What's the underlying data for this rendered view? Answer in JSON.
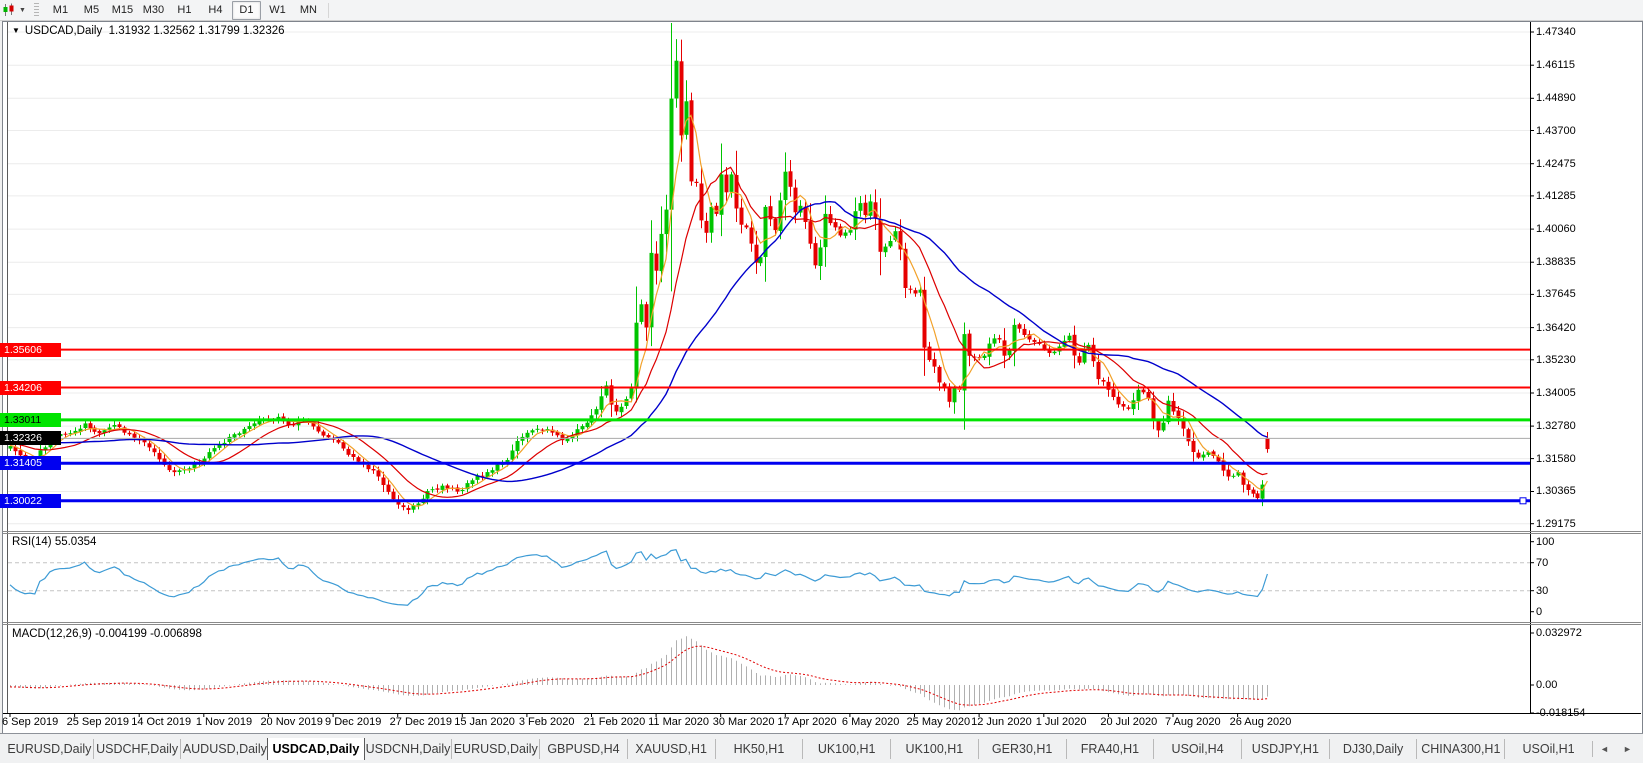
{
  "toolbar": {
    "timeframes": [
      "M1",
      "M5",
      "M15",
      "M30",
      "H1",
      "H4",
      "D1",
      "W1",
      "MN"
    ],
    "active_timeframe": "D1"
  },
  "chart_window": {
    "title": "USDCAD,Daily",
    "ohlc_text": "1.31932 1.32562 1.31799 1.32326"
  },
  "chart_data": {
    "type": "candlestick",
    "symbol": "USDCAD",
    "period": "Daily",
    "title": "USDCAD,Daily  1.31932 1.32562 1.31799 1.32326",
    "last_candle": {
      "open": 1.31932,
      "high": 1.32562,
      "low": 1.31799,
      "close": 1.32326,
      "render_color": "#e60000"
    },
    "candle_up_color": "#00c400",
    "candle_down_color": "#e60000",
    "grid_color": "#ececec",
    "price_axis": {
      "ticks": [
        "1.47340",
        "1.46115",
        "1.44890",
        "1.43700",
        "1.42475",
        "1.41285",
        "1.40060",
        "1.38835",
        "1.37645",
        "1.36420",
        "1.35230",
        "1.34005",
        "1.32780",
        "1.31580",
        "1.30365",
        "1.29175"
      ]
    },
    "time_axis": {
      "labels": [
        "6 Sep 2019",
        "25 Sep 2019",
        "14 Oct 2019",
        "1 Nov 2019",
        "20 Nov 2019",
        "9 Dec 2019",
        "27 Dec 2019",
        "15 Jan 2020",
        "3 Feb 2020",
        "21 Feb 2020",
        "11 Mar 2020",
        "30 Mar 2020",
        "17 Apr 2020",
        "6 May 2020",
        "25 May 2020",
        "12 Jun 2020",
        "1 Jul 2020",
        "20 Jul 2020",
        "7 Aug 2020",
        "26 Aug 2020"
      ],
      "label_interval_days": 13
    },
    "close_keypoints": [
      [
        0,
        1.3205
      ],
      [
        2,
        1.317
      ],
      [
        5,
        1.3152
      ],
      [
        8,
        1.323
      ],
      [
        12,
        1.3252
      ],
      [
        15,
        1.3288
      ],
      [
        18,
        1.3252
      ],
      [
        21,
        1.3282
      ],
      [
        24,
        1.3248
      ],
      [
        27,
        1.3218
      ],
      [
        30,
        1.3155
      ],
      [
        33,
        1.3108
      ],
      [
        36,
        1.3122
      ],
      [
        39,
        1.3158
      ],
      [
        42,
        1.3212
      ],
      [
        45,
        1.3248
      ],
      [
        48,
        1.3278
      ],
      [
        51,
        1.3302
      ],
      [
        54,
        1.3312
      ],
      [
        56,
        1.3282
      ],
      [
        59,
        1.33
      ],
      [
        62,
        1.3258
      ],
      [
        65,
        1.3228
      ],
      [
        68,
        1.3172
      ],
      [
        71,
        1.3138
      ],
      [
        74,
        1.3092
      ],
      [
        76,
        1.3035
      ],
      [
        78,
        1.2988
      ],
      [
        80,
        1.2968
      ],
      [
        82,
        1.2992
      ],
      [
        84,
        1.3038
      ],
      [
        87,
        1.3058
      ],
      [
        90,
        1.3036
      ],
      [
        93,
        1.3078
      ],
      [
        96,
        1.3108
      ],
      [
        99,
        1.3142
      ],
      [
        101,
        1.3188
      ],
      [
        103,
        1.3238
      ],
      [
        106,
        1.3268
      ],
      [
        109,
        1.3254
      ],
      [
        111,
        1.3226
      ],
      [
        113,
        1.3244
      ],
      [
        115,
        1.3278
      ],
      [
        117,
        1.3318
      ],
      [
        119,
        1.3388
      ],
      [
        120,
        1.3428
      ],
      [
        122,
        1.3332
      ],
      [
        124,
        1.3378
      ],
      [
        125,
        1.342
      ],
      [
        126,
        1.366
      ],
      [
        127,
        1.3728
      ],
      [
        128,
        1.3642
      ],
      [
        129,
        1.3918
      ],
      [
        130,
        1.3852
      ],
      [
        131,
        1.3988
      ],
      [
        132,
        1.4078
      ],
      [
        133,
        1.4488
      ],
      [
        134,
        1.4628
      ],
      [
        135,
        1.4352
      ],
      [
        136,
        1.4478
      ],
      [
        137,
        1.4182
      ],
      [
        138,
        1.4176
      ],
      [
        139,
        1.4038
      ],
      [
        140,
        1.3992
      ],
      [
        141,
        1.4088
      ],
      [
        142,
        1.4062
      ],
      [
        143,
        1.4208
      ],
      [
        144,
        1.4142
      ],
      [
        145,
        1.4208
      ],
      [
        146,
        1.4082
      ],
      [
        147,
        1.4022
      ],
      [
        148,
        1.4012
      ],
      [
        149,
        1.3952
      ],
      [
        150,
        1.3882
      ],
      [
        151,
        1.3902
      ],
      [
        152,
        1.4088
      ],
      [
        153,
        1.4042
      ],
      [
        154,
        1.4002
      ],
      [
        155,
        1.4112
      ],
      [
        156,
        1.4218
      ],
      [
        157,
        1.4162
      ],
      [
        158,
        1.4068
      ],
      [
        159,
        1.4092
      ],
      [
        160,
        1.4032
      ],
      [
        161,
        1.3952
      ],
      [
        162,
        1.3872
      ],
      [
        163,
        1.3938
      ],
      [
        164,
        1.4062
      ],
      [
        165,
        1.4028
      ],
      [
        167,
        1.3982
      ],
      [
        169,
        1.4002
      ],
      [
        171,
        1.4102
      ],
      [
        172,
        1.4058
      ],
      [
        173,
        1.4108
      ],
      [
        175,
        1.3922
      ],
      [
        177,
        1.3962
      ],
      [
        178,
        1.3998
      ],
      [
        180,
        1.3788
      ],
      [
        182,
        1.3768
      ],
      [
        183,
        1.3782
      ],
      [
        184,
        1.3568
      ],
      [
        185,
        1.3522
      ],
      [
        186,
        1.3498
      ],
      [
        188,
        1.3422
      ],
      [
        189,
        1.3368
      ],
      [
        190,
        1.3422
      ],
      [
        191,
        1.3412
      ],
      [
        192,
        1.3618
      ],
      [
        193,
        1.3538
      ],
      [
        195,
        1.3532
      ],
      [
        196,
        1.3538
      ],
      [
        198,
        1.3602
      ],
      [
        199,
        1.3598
      ],
      [
        200,
        1.3538
      ],
      [
        201,
        1.3558
      ],
      [
        202,
        1.3652
      ],
      [
        203,
        1.3638
      ],
      [
        205,
        1.3598
      ],
      [
        207,
        1.3582
      ],
      [
        209,
        1.3548
      ],
      [
        211,
        1.3572
      ],
      [
        213,
        1.3612
      ],
      [
        215,
        1.3512
      ],
      [
        217,
        1.3578
      ],
      [
        219,
        1.3452
      ],
      [
        221,
        1.3412
      ],
      [
        223,
        1.3358
      ],
      [
        225,
        1.3342
      ],
      [
        227,
        1.3412
      ],
      [
        229,
        1.3382
      ],
      [
        231,
        1.3262
      ],
      [
        233,
        1.3372
      ],
      [
        235,
        1.3308
      ],
      [
        237,
        1.3222
      ],
      [
        239,
        1.3162
      ],
      [
        241,
        1.3182
      ],
      [
        243,
        1.3148
      ],
      [
        245,
        1.3092
      ],
      [
        247,
        1.3108
      ],
      [
        249,
        1.3042
      ],
      [
        250,
        1.3028
      ],
      [
        251,
        1.3012
      ],
      [
        252,
        1.3062
      ],
      [
        253,
        1.32326
      ]
    ],
    "moving_averages": [
      {
        "name": "ma-fast",
        "period": 5,
        "color": "#f2a129",
        "width": 1.2
      },
      {
        "name": "ma-mid",
        "period": 13,
        "color": "#dd0000",
        "width": 1.2
      },
      {
        "name": "ma-slow",
        "period": 34,
        "color": "#0000cc",
        "width": 1.4
      }
    ],
    "horizontal_lines": [
      {
        "price": 1.35606,
        "text": "1.35606",
        "color": "#ff0000",
        "thickness": 2,
        "badge_bg": "#ff0000",
        "badge_fg": "#ffffff"
      },
      {
        "price": 1.34206,
        "text": "1.34206",
        "color": "#ff0000",
        "thickness": 2,
        "badge_bg": "#ff0000",
        "badge_fg": "#ffffff"
      },
      {
        "price": 1.33011,
        "text": "1.33011",
        "color": "#00e400",
        "thickness": 3,
        "badge_bg": "#00e400",
        "badge_fg": "#000000"
      },
      {
        "price": 1.31405,
        "text": "1.31405",
        "color": "#0000f0",
        "thickness": 3,
        "badge_bg": "#0000f0",
        "badge_fg": "#ffffff"
      },
      {
        "price": 1.30022,
        "text": "1.30022",
        "color": "#0000f0",
        "thickness": 3,
        "badge_bg": "#0000f0",
        "badge_fg": "#ffffff",
        "selected": true
      }
    ],
    "bid_line": {
      "price": 1.32326,
      "text": "1.32326",
      "color": "#aaaaaa",
      "thickness": 1,
      "badge_bg": "#000000",
      "badge_fg": "#ffffff"
    },
    "indicators": {
      "rsi": {
        "label": "RSI(14) 55.0354",
        "period": 14,
        "current": 55.0354,
        "ticks": [
          100,
          70,
          30,
          0
        ],
        "levels": [
          70,
          30
        ],
        "line_color": "#3d9bd5",
        "level_color": "#c4c4c4"
      },
      "macd": {
        "label": "MACD(12,26,9) -0.004199 -0.006898",
        "fast": 12,
        "slow": 26,
        "signal": 9,
        "main_value": -0.004199,
        "signal_value": -0.006898,
        "ticks": [
          "0.032972",
          "0.00",
          "-0.018154"
        ],
        "histogram_color": "#b0b0b0",
        "signal_color": "#e00000"
      }
    }
  },
  "tabs": {
    "items": [
      "EURUSD,Daily",
      "USDCHF,Daily",
      "AUDUSD,Daily",
      "USDCAD,Daily",
      "USDCNH,Daily",
      "EURUSD,Daily",
      "GBPUSD,H4",
      "XAUUSD,H1",
      "HK50,H1",
      "UK100,H1",
      "UK100,H1",
      "GER30,H1",
      "FRA40,H1",
      "USOil,H4",
      "USDJPY,H1",
      "DJ30,Daily",
      "CHINA300,H1",
      "USOil,H1"
    ],
    "active_index": 3,
    "scroll_left": "◄",
    "scroll_right": "►"
  }
}
